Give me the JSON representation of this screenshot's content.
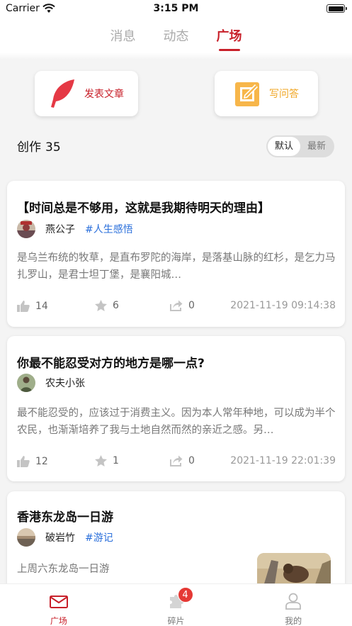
{
  "status_bar": {
    "carrier": "Carrier",
    "time": "3:15 PM"
  },
  "top_tabs": [
    {
      "label": "消息",
      "active": false
    },
    {
      "label": "动态",
      "active": false
    },
    {
      "label": "广场",
      "active": true
    }
  ],
  "actions": {
    "publish_label": "发表文章",
    "answer_label": "写问答"
  },
  "creation": {
    "label": "创作",
    "count": "35"
  },
  "sort": {
    "default_label": "默认",
    "latest_label": "最新",
    "selected": "默认"
  },
  "posts": [
    {
      "title": "【时间总是不够用，这就是我期待明天的理由】",
      "author": "燕公子",
      "tag": "#人生感悟",
      "excerpt": "是乌兰布统的牧草，是直布罗陀的海岸，是落基山脉的红杉，是乞力马扎罗山，是君士坦丁堡，是襄阳城…",
      "likes": "14",
      "favorites": "6",
      "shares": "0",
      "date": "2021-11-19 09:14:38"
    },
    {
      "title": "你最不能忍受对方的地方是哪一点?",
      "author": "农夫小张",
      "tag": "",
      "excerpt": "最不能忍受的，应该过于消费主义。因为本人常年种地，可以成为半个农民，也渐渐培养了我与土地自然而然的亲近之感。另…",
      "likes": "12",
      "favorites": "1",
      "shares": "0",
      "date": "2021-11-19 22:01:39"
    },
    {
      "title": "香港东龙岛一日游",
      "author": "破岩竹",
      "tag": "#游记",
      "excerpt": "上周六东龙岛一日游"
    }
  ],
  "tab_bar": [
    {
      "label": "广场",
      "icon": "plaza-envelope-icon",
      "active": true
    },
    {
      "label": "碎片",
      "icon": "puzzle-icon",
      "badge": "4",
      "active": false
    },
    {
      "label": "我的",
      "icon": "profile-icon",
      "active": false
    }
  ],
  "colors": {
    "accent": "#c8202a",
    "tag": "#2a6fdb",
    "answer": "#f0a623",
    "badge": "#e53935"
  }
}
